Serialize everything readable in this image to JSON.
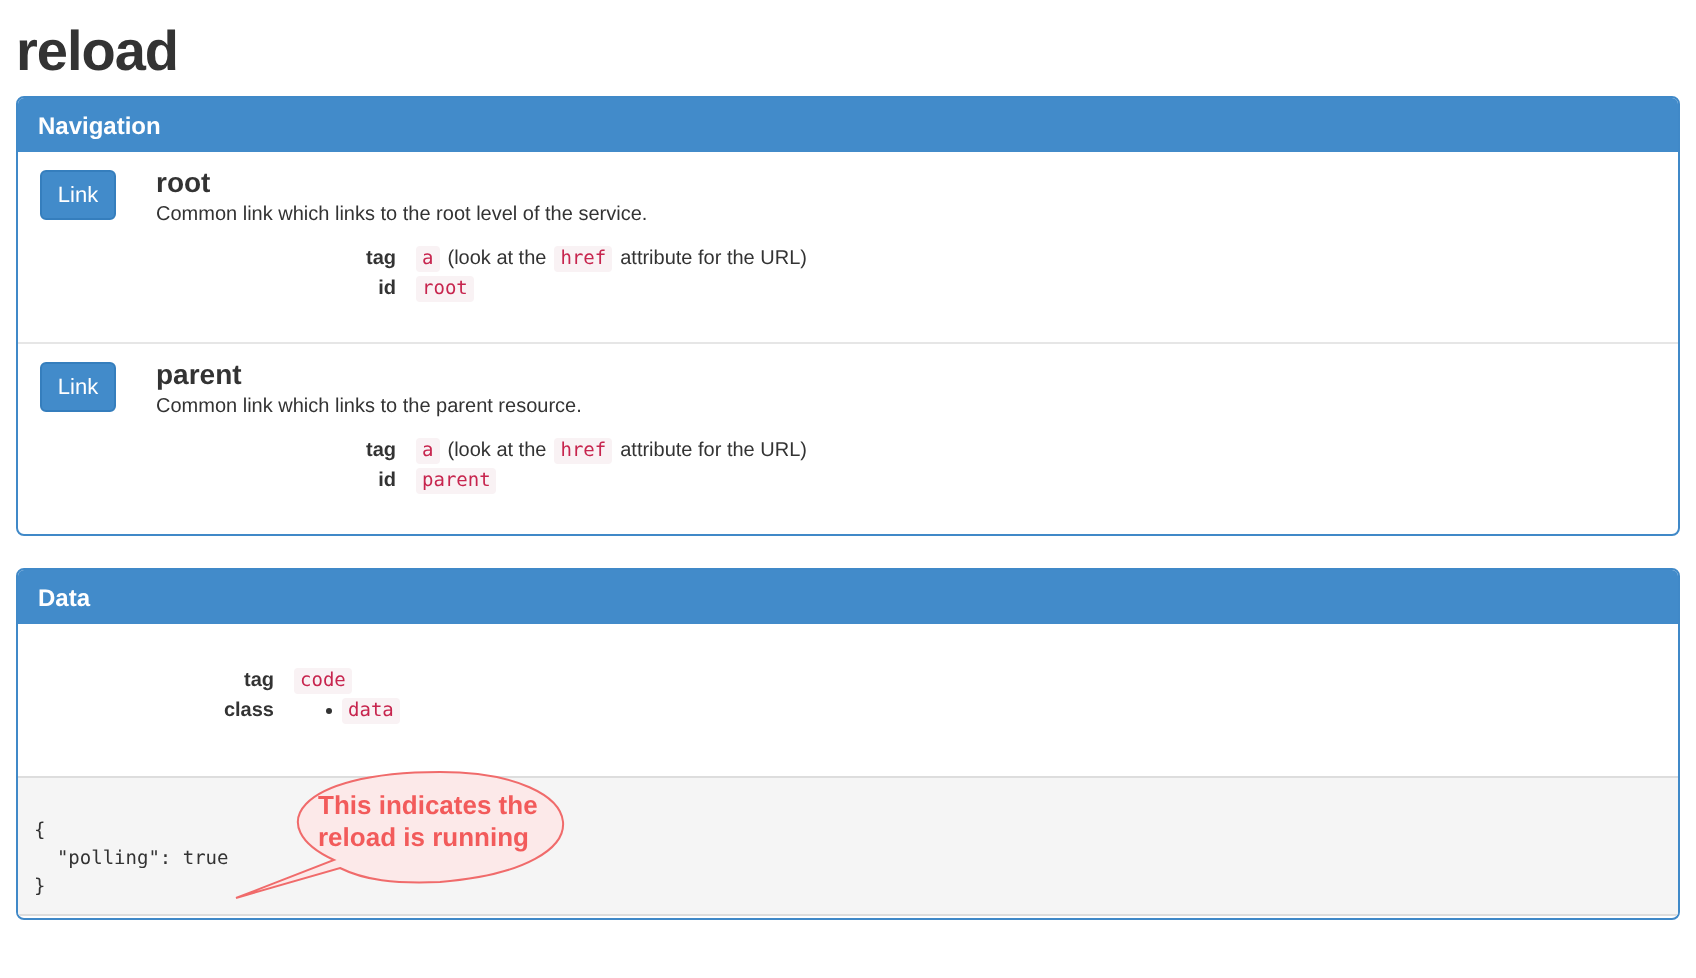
{
  "title": "reload",
  "navigation": {
    "heading": "Navigation",
    "links": [
      {
        "button": "Link",
        "name": "root",
        "description": "Common link which links to the root level of the service.",
        "tag_label": "tag",
        "tag_parts": [
          {
            "kind": "code",
            "text": "a"
          },
          {
            "kind": "text",
            "text": "(look at the"
          },
          {
            "kind": "code",
            "text": "href"
          },
          {
            "kind": "text",
            "text": "attribute for the URL)"
          }
        ],
        "id_label": "id",
        "id": "root"
      },
      {
        "button": "Link",
        "name": "parent",
        "description": "Common link which links to the parent resource.",
        "tag_label": "tag",
        "tag_parts": [
          {
            "kind": "code",
            "text": "a"
          },
          {
            "kind": "text",
            "text": "(look at the"
          },
          {
            "kind": "code",
            "text": "href"
          },
          {
            "kind": "text",
            "text": "attribute for the URL)"
          }
        ],
        "id_label": "id",
        "id": "parent"
      }
    ]
  },
  "data": {
    "heading": "Data",
    "tag_label": "tag",
    "tag": "code",
    "class_label": "class",
    "classes": [
      "data"
    ],
    "json": "{\n  \"polling\": true\n}",
    "callout": "This indicates the reload is running"
  }
}
